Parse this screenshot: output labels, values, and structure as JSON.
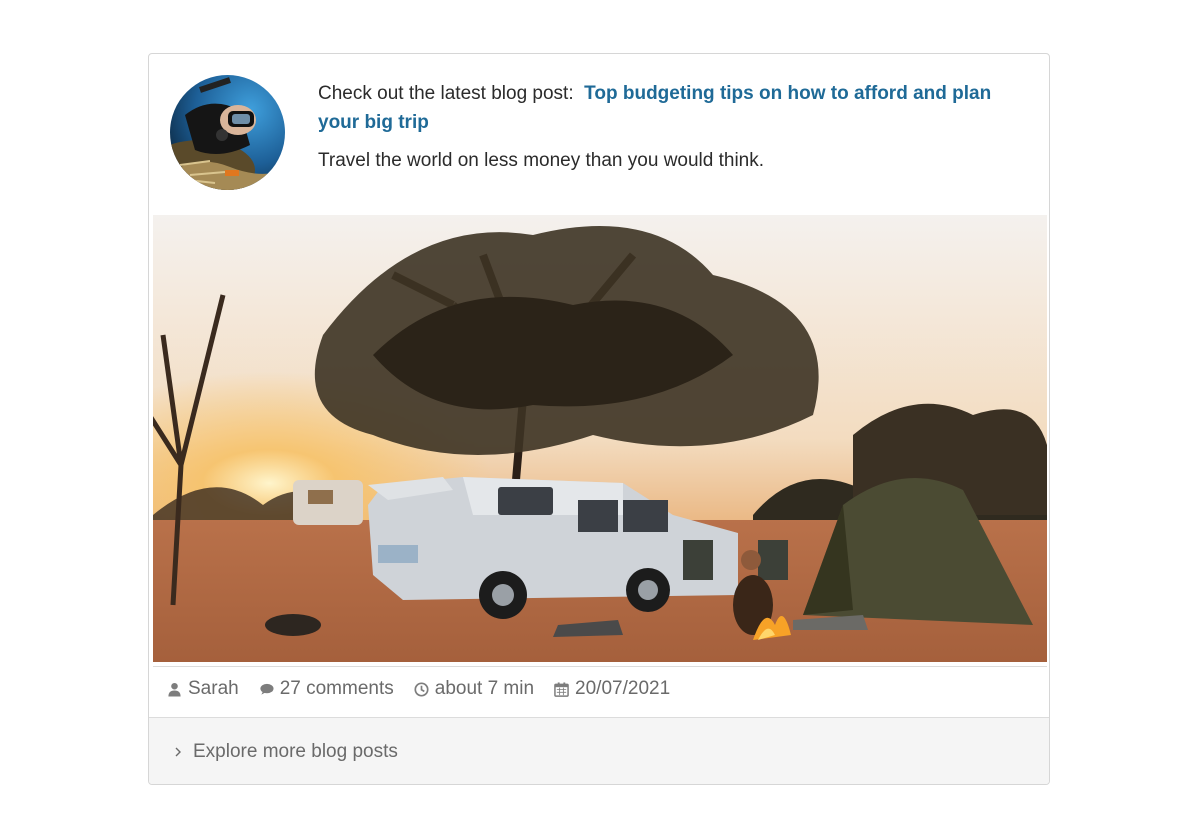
{
  "post": {
    "intro_prefix": "Check out the latest blog post:",
    "title": "Top budgeting tips on how to afford and plan your big trip",
    "lead": "Travel the world on less money than you would think."
  },
  "meta": {
    "author": "Sarah",
    "comments": "27 comments",
    "read_time": "about 7 min",
    "date": "20/07/2021"
  },
  "footer": {
    "link_label": "Explore more blog posts"
  },
  "icons": {
    "author": "user-icon",
    "comments": "comment-icon",
    "read_time": "clock-icon",
    "date": "calendar-icon",
    "footer": "chevron-right-icon"
  },
  "colors": {
    "link": "#1f6a97",
    "text": "#2b2b2b",
    "meta": "#6a6a6a",
    "footer_bg": "#f5f5f5"
  }
}
